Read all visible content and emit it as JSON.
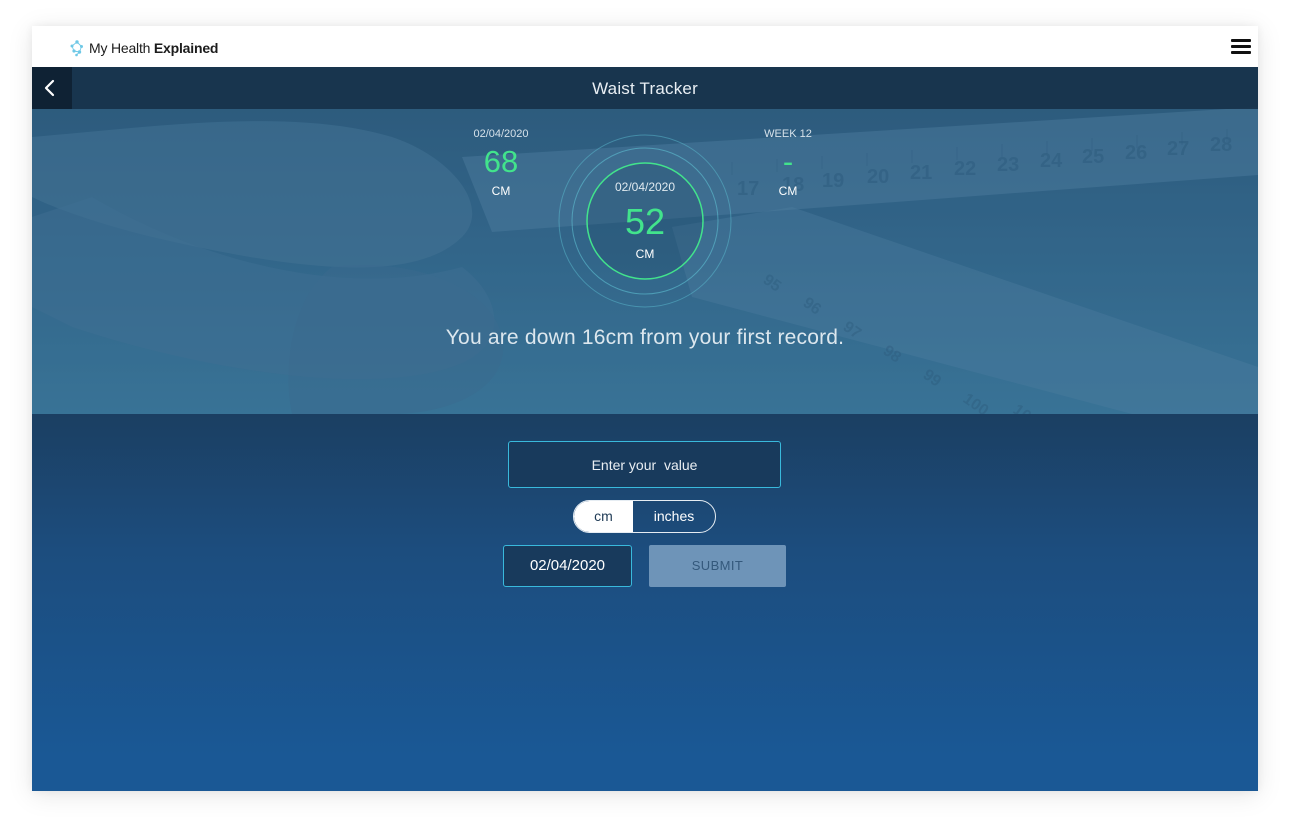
{
  "brand": {
    "name_regular": "My Health ",
    "name_bold": "Explained",
    "logo_icon": "molecule-icon"
  },
  "header": {
    "menu_icon": "hamburger-menu-icon",
    "back_icon": "chevron-left-icon",
    "title": "Waist Tracker"
  },
  "stats": {
    "first": {
      "label": "02/04/2020",
      "value": "68",
      "unit": "CM"
    },
    "current": {
      "label": "02/04/2020",
      "value": "52",
      "unit": "CM"
    },
    "week": {
      "label": "WEEK 12",
      "value": "-",
      "unit": "CM"
    }
  },
  "message": "You are down 16cm from your first record.",
  "form": {
    "value_placeholder": "Enter your  value",
    "units": [
      "cm",
      "inches"
    ],
    "selected_unit": "cm",
    "date": "02/04/2020",
    "submit_label": "SUBMIT"
  },
  "colors": {
    "accent_green": "#42e38c",
    "input_border": "#39b9dc",
    "submit_bg": "#6e94b8"
  }
}
